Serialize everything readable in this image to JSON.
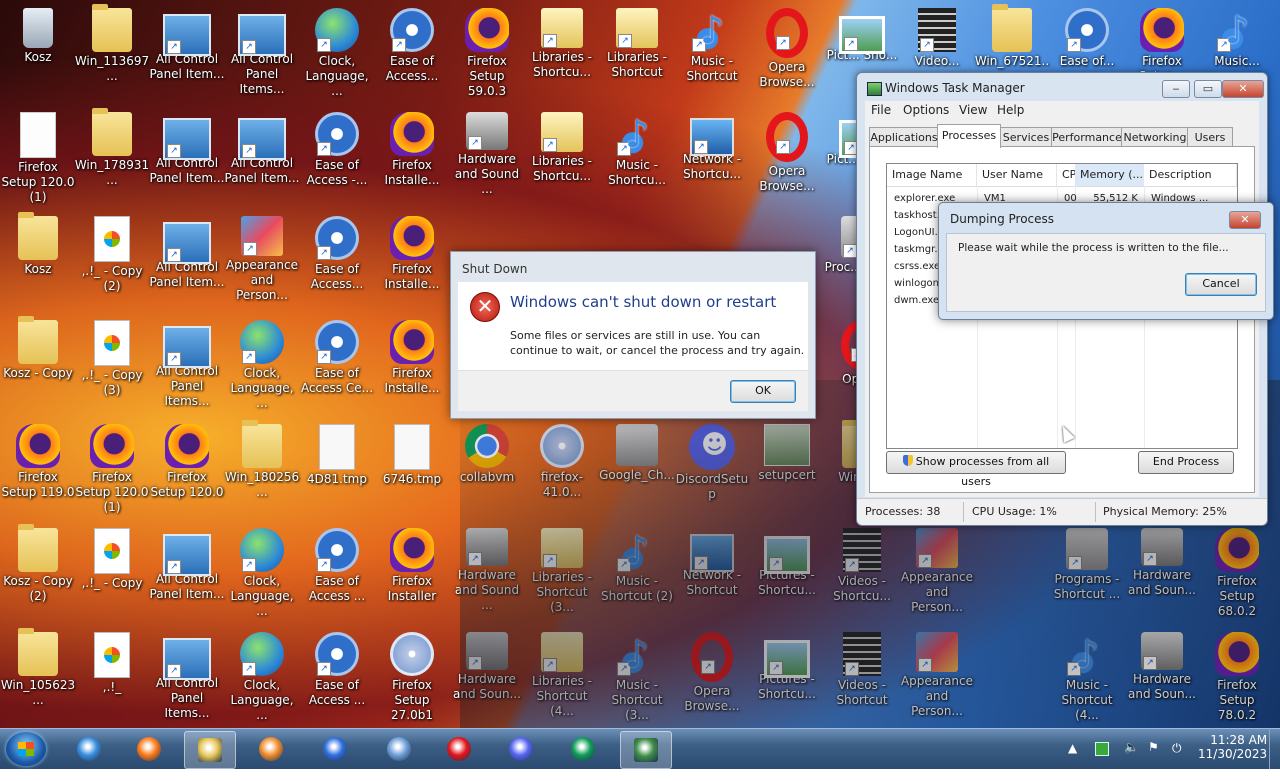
{
  "desktop": {
    "icons": [
      {
        "label": "Kosz",
        "icon": "recycle-bin-icon",
        "kind": "trash"
      },
      {
        "label": "Win_113697...",
        "icon": "folder-icon",
        "kind": "folder"
      },
      {
        "label": "All Control Panel Item...",
        "icon": "control-panel-icon",
        "kind": "cpl",
        "sc": true
      },
      {
        "label": "All Control Panel Items...",
        "icon": "control-panel-icon",
        "kind": "cpl",
        "sc": true
      },
      {
        "label": "Clock, Language, ...",
        "icon": "globe-clock-icon",
        "kind": "globe",
        "sc": true
      },
      {
        "label": "Ease of Access...",
        "icon": "ease-of-access-icon",
        "kind": "ease",
        "sc": true
      },
      {
        "label": "Firefox Setup 59.0.3",
        "icon": "firefox-setup-icon",
        "kind": "ff"
      },
      {
        "label": "Libraries - Shortcu...",
        "icon": "libraries-icon",
        "kind": "lib",
        "sc": true
      },
      {
        "label": "Libraries - Shortcut",
        "icon": "libraries-icon",
        "kind": "lib",
        "sc": true
      },
      {
        "label": "Music - Shortcut",
        "icon": "music-icon",
        "kind": "music",
        "sc": true
      },
      {
        "label": "Opera Browse...",
        "icon": "opera-icon",
        "kind": "opera",
        "sc": true
      },
      {
        "label": "Pict... Sho...",
        "icon": "pictures-icon",
        "kind": "pic",
        "sc": true
      },
      {
        "label": "Video...",
        "icon": "video-icon",
        "kind": "video",
        "sc": true
      },
      {
        "label": "Win_67521...",
        "icon": "folder-icon",
        "kind": "folder"
      },
      {
        "label": "Ease of...",
        "icon": "ease-of-access-icon",
        "kind": "ease",
        "sc": true
      },
      {
        "label": "Firefox Setup...",
        "icon": "firefox-setup-icon",
        "kind": "ff"
      },
      {
        "label": "Music...",
        "icon": "music-icon",
        "kind": "music",
        "sc": true
      },
      {
        "label": "Firefox Setup 120.0 (1)",
        "icon": "document-icon",
        "kind": "blank"
      },
      {
        "label": "Win_178931...",
        "icon": "folder-icon",
        "kind": "folder"
      },
      {
        "label": "All Control Panel Item...",
        "icon": "control-panel-icon",
        "kind": "cpl",
        "sc": true
      },
      {
        "label": "All Control Panel Item...",
        "icon": "control-panel-icon",
        "kind": "cpl",
        "sc": true
      },
      {
        "label": "Ease of Access -...",
        "icon": "ease-of-access-icon",
        "kind": "ease",
        "sc": true
      },
      {
        "label": "Firefox Installe...",
        "icon": "firefox-installer-icon",
        "kind": "ff"
      },
      {
        "label": "Hardware and Sound ...",
        "icon": "hardware-sound-icon",
        "kind": "hw",
        "sc": true
      },
      {
        "label": "Libraries - Shortcu...",
        "icon": "libraries-icon",
        "kind": "lib",
        "sc": true
      },
      {
        "label": "Music - Shortcu...",
        "icon": "music-icon",
        "kind": "music",
        "sc": true
      },
      {
        "label": "Network - Shortcu...",
        "icon": "network-icon",
        "kind": "net",
        "sc": true
      },
      {
        "label": "Opera Browse...",
        "icon": "opera-icon",
        "kind": "opera",
        "sc": true
      },
      {
        "label": "Pict... Sho...",
        "icon": "pictures-icon",
        "kind": "pic",
        "sc": true
      },
      {
        "label": "Kosz",
        "icon": "folder-icon",
        "kind": "folder"
      },
      {
        "label": ",.!_ - Copy (2)",
        "icon": "document-icon",
        "kind": "doc"
      },
      {
        "label": "All Control Panel Item...",
        "icon": "control-panel-icon",
        "kind": "cpl",
        "sc": true
      },
      {
        "label": "Appearance and Person...",
        "icon": "appearance-icon",
        "kind": "app",
        "sc": true
      },
      {
        "label": "Ease of Access...",
        "icon": "ease-of-access-icon",
        "kind": "ease",
        "sc": true
      },
      {
        "label": "Firefox Installe...",
        "icon": "firefox-installer-icon",
        "kind": "ff"
      },
      {
        "label": "Proc... Sho...",
        "icon": "programs-icon",
        "kind": "gc",
        "sc": true
      },
      {
        "label": "Kosz - Copy",
        "icon": "folder-icon",
        "kind": "folder"
      },
      {
        "label": ",.!_ - Copy (3)",
        "icon": "document-icon",
        "kind": "doc"
      },
      {
        "label": "All Control Panel Items...",
        "icon": "control-panel-icon",
        "kind": "cpl",
        "sc": true
      },
      {
        "label": "Clock, Language, ...",
        "icon": "globe-clock-icon",
        "kind": "globe",
        "sc": true
      },
      {
        "label": "Ease of Access Ce...",
        "icon": "ease-of-access-icon",
        "kind": "ease",
        "sc": true
      },
      {
        "label": "Firefox Installe...",
        "icon": "firefox-installer-icon",
        "kind": "ff"
      },
      {
        "label": "Oper...",
        "icon": "opera-icon",
        "kind": "opera",
        "sc": true
      },
      {
        "label": "Firefox Setup 119.0",
        "icon": "firefox-setup-icon",
        "kind": "ff"
      },
      {
        "label": "Firefox Setup 120.0 (1)",
        "icon": "firefox-setup-icon",
        "kind": "ff"
      },
      {
        "label": "Firefox Setup 120.0",
        "icon": "firefox-setup-icon",
        "kind": "ff"
      },
      {
        "label": "Win_180256...",
        "icon": "folder-icon",
        "kind": "folder"
      },
      {
        "label": "4D81.tmp",
        "icon": "tmp-file-icon",
        "kind": "tmp"
      },
      {
        "label": "6746.tmp",
        "icon": "tmp-file-icon",
        "kind": "tmp"
      },
      {
        "label": "collabvm",
        "icon": "chrome-icon",
        "kind": "chrome"
      },
      {
        "label": "firefox-41.0...",
        "icon": "installer-disc-icon",
        "kind": "disc"
      },
      {
        "label": "Google_Ch...",
        "icon": "installer-box-icon",
        "kind": "gc"
      },
      {
        "label": "DiscordSetup",
        "icon": "discord-icon",
        "kind": "discord"
      },
      {
        "label": "setupcert",
        "icon": "setup-icon",
        "kind": "setup"
      },
      {
        "label": "Win_1...",
        "icon": "folder-icon",
        "kind": "folder"
      },
      {
        "label": "Kosz - Copy (2)",
        "icon": "folder-icon",
        "kind": "folder"
      },
      {
        "label": ",.!_ - Copy",
        "icon": "document-icon",
        "kind": "doc"
      },
      {
        "label": "All Control Panel Item...",
        "icon": "control-panel-icon",
        "kind": "cpl",
        "sc": true
      },
      {
        "label": "Clock, Language, ...",
        "icon": "globe-clock-icon",
        "kind": "globe",
        "sc": true
      },
      {
        "label": "Ease of Access ...",
        "icon": "ease-of-access-icon",
        "kind": "ease",
        "sc": true
      },
      {
        "label": "Firefox Installer",
        "icon": "firefox-installer-icon",
        "kind": "ff"
      },
      {
        "label": "Hardware and Sound ...",
        "icon": "hardware-sound-icon",
        "kind": "hw",
        "sc": true
      },
      {
        "label": "Libraries - Shortcut (3...",
        "icon": "libraries-icon",
        "kind": "lib",
        "sc": true
      },
      {
        "label": "Music - Shortcut (2)",
        "icon": "music-icon",
        "kind": "music",
        "sc": true
      },
      {
        "label": "Network - Shortcut",
        "icon": "network-icon",
        "kind": "net",
        "sc": true
      },
      {
        "label": "Pictures - Shortcu...",
        "icon": "pictures-icon",
        "kind": "pic",
        "sc": true
      },
      {
        "label": "Videos - Shortcu...",
        "icon": "video-icon",
        "kind": "video",
        "sc": true
      },
      {
        "label": "Appearance and Person...",
        "icon": "appearance-icon",
        "kind": "app",
        "sc": true
      },
      {
        "label": "Programs - Shortcut ...",
        "icon": "programs-icon",
        "kind": "gc",
        "sc": true
      },
      {
        "label": "Hardware and Soun...",
        "icon": "hardware-sound-icon",
        "kind": "hw",
        "sc": true
      },
      {
        "label": "Firefox Setup 68.0.2",
        "icon": "firefox-setup-icon",
        "kind": "ff"
      },
      {
        "label": "Win_105623...",
        "icon": "folder-icon",
        "kind": "folder"
      },
      {
        "label": ",.!_",
        "icon": "document-icon",
        "kind": "doc"
      },
      {
        "label": "All Control Panel Items...",
        "icon": "control-panel-icon",
        "kind": "cpl",
        "sc": true
      },
      {
        "label": "Clock, Language, ...",
        "icon": "globe-clock-icon",
        "kind": "globe",
        "sc": true
      },
      {
        "label": "Ease of Access ...",
        "icon": "ease-of-access-icon",
        "kind": "ease",
        "sc": true
      },
      {
        "label": "Firefox Setup 27.0b1",
        "icon": "installer-disc-icon",
        "kind": "disc"
      },
      {
        "label": "Hardware and Soun...",
        "icon": "hardware-sound-icon",
        "kind": "hw",
        "sc": true
      },
      {
        "label": "Libraries - Shortcut (4...",
        "icon": "libraries-icon",
        "kind": "lib",
        "sc": true
      },
      {
        "label": "Music - Shortcut (3...",
        "icon": "music-icon",
        "kind": "music",
        "sc": true
      },
      {
        "label": "Opera Browse...",
        "icon": "opera-icon",
        "kind": "opera",
        "sc": true
      },
      {
        "label": "Pictures - Shortcu...",
        "icon": "pictures-icon",
        "kind": "pic",
        "sc": true
      },
      {
        "label": "Videos - Shortcut",
        "icon": "video-icon",
        "kind": "video",
        "sc": true
      },
      {
        "label": "Appearance and Person...",
        "icon": "appearance-icon",
        "kind": "app",
        "sc": true
      },
      {
        "label": "Music - Shortcut (4...",
        "icon": "music-icon",
        "kind": "music",
        "sc": true
      },
      {
        "label": "Hardware and Soun...",
        "icon": "hardware-sound-icon",
        "kind": "hw",
        "sc": true
      },
      {
        "label": "Firefox Setup 78.0.2",
        "icon": "firefox-setup-icon",
        "kind": "ff"
      }
    ]
  },
  "taskmgr": {
    "title": "Windows Task Manager",
    "controls": {
      "minimize": "‒",
      "maximize": "▭",
      "close": "✕"
    },
    "menu": [
      "File",
      "Options",
      "View",
      "Help"
    ],
    "tabs": [
      "Applications",
      "Processes",
      "Services",
      "Performance",
      "Networking",
      "Users"
    ],
    "active_tab": "Processes",
    "columns": [
      "Image Name",
      "User Name",
      "CPU",
      "Memory (...",
      "Description"
    ],
    "rows": [
      {
        "image": "explorer.exe",
        "user": "VM1",
        "cpu": "00",
        "mem": "55,512 K",
        "desc": "Windows ..."
      },
      {
        "image": "taskhost.",
        "user": "",
        "cpu": "",
        "mem": "",
        "desc": ""
      },
      {
        "image": "LogonUI.",
        "user": "",
        "cpu": "",
        "mem": "",
        "desc": ""
      },
      {
        "image": "taskmgr.e",
        "user": "",
        "cpu": "",
        "mem": "",
        "desc": ""
      },
      {
        "image": "csrss.exe",
        "user": "",
        "cpu": "",
        "mem": "",
        "desc": ""
      },
      {
        "image": "winlogon.",
        "user": "",
        "cpu": "",
        "mem": "",
        "desc": ""
      },
      {
        "image": "dwm.exe",
        "user": "",
        "cpu": "",
        "mem": "",
        "desc": ""
      }
    ],
    "show_all_label": "Show processes from all users",
    "end_process_label": "End Process",
    "status": {
      "processes": "Processes: 38",
      "cpu": "CPU Usage: 1%",
      "memory": "Physical Memory: 25%"
    }
  },
  "dump": {
    "title": "Dumping Process",
    "message": "Please wait while the process is written to the file...",
    "cancel_label": "Cancel",
    "close": "✕"
  },
  "shutdown": {
    "title": "Shut Down",
    "headline": "Windows can't shut down or restart",
    "body": "Some files or services are still in use. You can continue to wait, or cancel the process and try again.",
    "ok_label": "OK",
    "error_glyph": "✕"
  },
  "taskbar": {
    "pinned": [
      {
        "name": "internet-explorer-icon",
        "color": "#3a8fe0"
      },
      {
        "name": "firefox-icon",
        "color": "#ff7b19"
      },
      {
        "name": "explorer-folder-icon",
        "color": "#e8c85a"
      },
      {
        "name": "media-player-icon",
        "color": "#f28c2a"
      },
      {
        "name": "firefox-blue-icon",
        "color": "#2f6fe0"
      },
      {
        "name": "chromium-icon",
        "color": "#6fa0d8"
      },
      {
        "name": "opera-icon",
        "color": "#e3161b"
      },
      {
        "name": "discord-icon",
        "color": "#5865f2"
      },
      {
        "name": "chrome-icon",
        "color": "#0f9d58"
      },
      {
        "name": "task-manager-icon",
        "color": "#3f8f4a"
      }
    ],
    "time": "11:28 AM",
    "date": "11/30/2023"
  }
}
